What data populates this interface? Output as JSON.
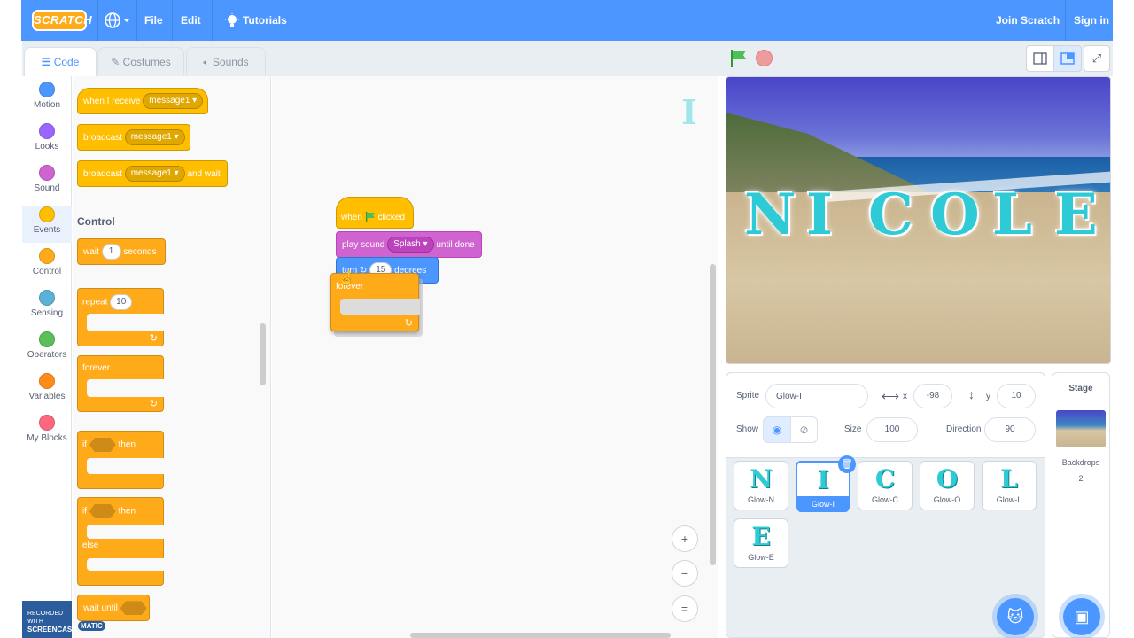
{
  "topbar": {
    "logo": "SCRATCH",
    "file": "File",
    "edit": "Edit",
    "tutorials": "Tutorials",
    "join": "Join Scratch",
    "signin": "Sign in"
  },
  "tabs": {
    "code": "Code",
    "costumes": "Costumes",
    "sounds": "Sounds"
  },
  "categories": [
    {
      "label": "Motion",
      "color": "#4c97ff"
    },
    {
      "label": "Looks",
      "color": "#9966ff"
    },
    {
      "label": "Sound",
      "color": "#cf63cf"
    },
    {
      "label": "Events",
      "color": "#ffbf00"
    },
    {
      "label": "Control",
      "color": "#ffab19"
    },
    {
      "label": "Sensing",
      "color": "#5cb1d6"
    },
    {
      "label": "Operators",
      "color": "#59c059"
    },
    {
      "label": "Variables",
      "color": "#ff8c1a"
    },
    {
      "label": "My Blocks",
      "color": "#ff6680"
    }
  ],
  "palette": {
    "when_receive": "when I receive",
    "message1": "message1",
    "broadcast": "broadcast",
    "and_wait": "and wait",
    "control_heading": "Control",
    "wait": "wait",
    "wait_val": "1",
    "seconds": "seconds",
    "repeat": "repeat",
    "repeat_val": "10",
    "forever": "forever",
    "if": "if",
    "then": "then",
    "else": "else",
    "wait_until": "wait until"
  },
  "script": {
    "when": "when",
    "clicked": "clicked",
    "play_sound": "play sound",
    "sound_name": "Splash",
    "until_done": "until done",
    "turn": "turn",
    "degrees_val": "15",
    "degrees": "degrees",
    "forever": "forever",
    "sprite_letter": "I"
  },
  "zoom": {
    "in": "+",
    "out": "−",
    "reset": "="
  },
  "stage": {
    "letters": [
      "N",
      "I",
      "C",
      "O",
      "L",
      "E"
    ]
  },
  "sprite_info": {
    "sprite_label": "Sprite",
    "sprite_name": "Glow-I",
    "x_label": "x",
    "x_val": "-98",
    "y_label": "y",
    "y_val": "10",
    "show_label": "Show",
    "size_label": "Size",
    "size_val": "100",
    "direction_label": "Direction",
    "direction_val": "90"
  },
  "sprites": [
    {
      "glyph": "N",
      "name": "Glow-N"
    },
    {
      "glyph": "I",
      "name": "Glow-I"
    },
    {
      "glyph": "C",
      "name": "Glow-C"
    },
    {
      "glyph": "O",
      "name": "Glow-O"
    },
    {
      "glyph": "L",
      "name": "Glow-L"
    },
    {
      "glyph": "E",
      "name": "Glow-E"
    }
  ],
  "stage_panel": {
    "title": "Stage",
    "backdrops_label": "Backdrops",
    "backdrops_count": "2"
  },
  "watermark": {
    "line1": "RECORDED WITH",
    "line2": "SCREENCAST",
    "line3": "MATIC"
  }
}
